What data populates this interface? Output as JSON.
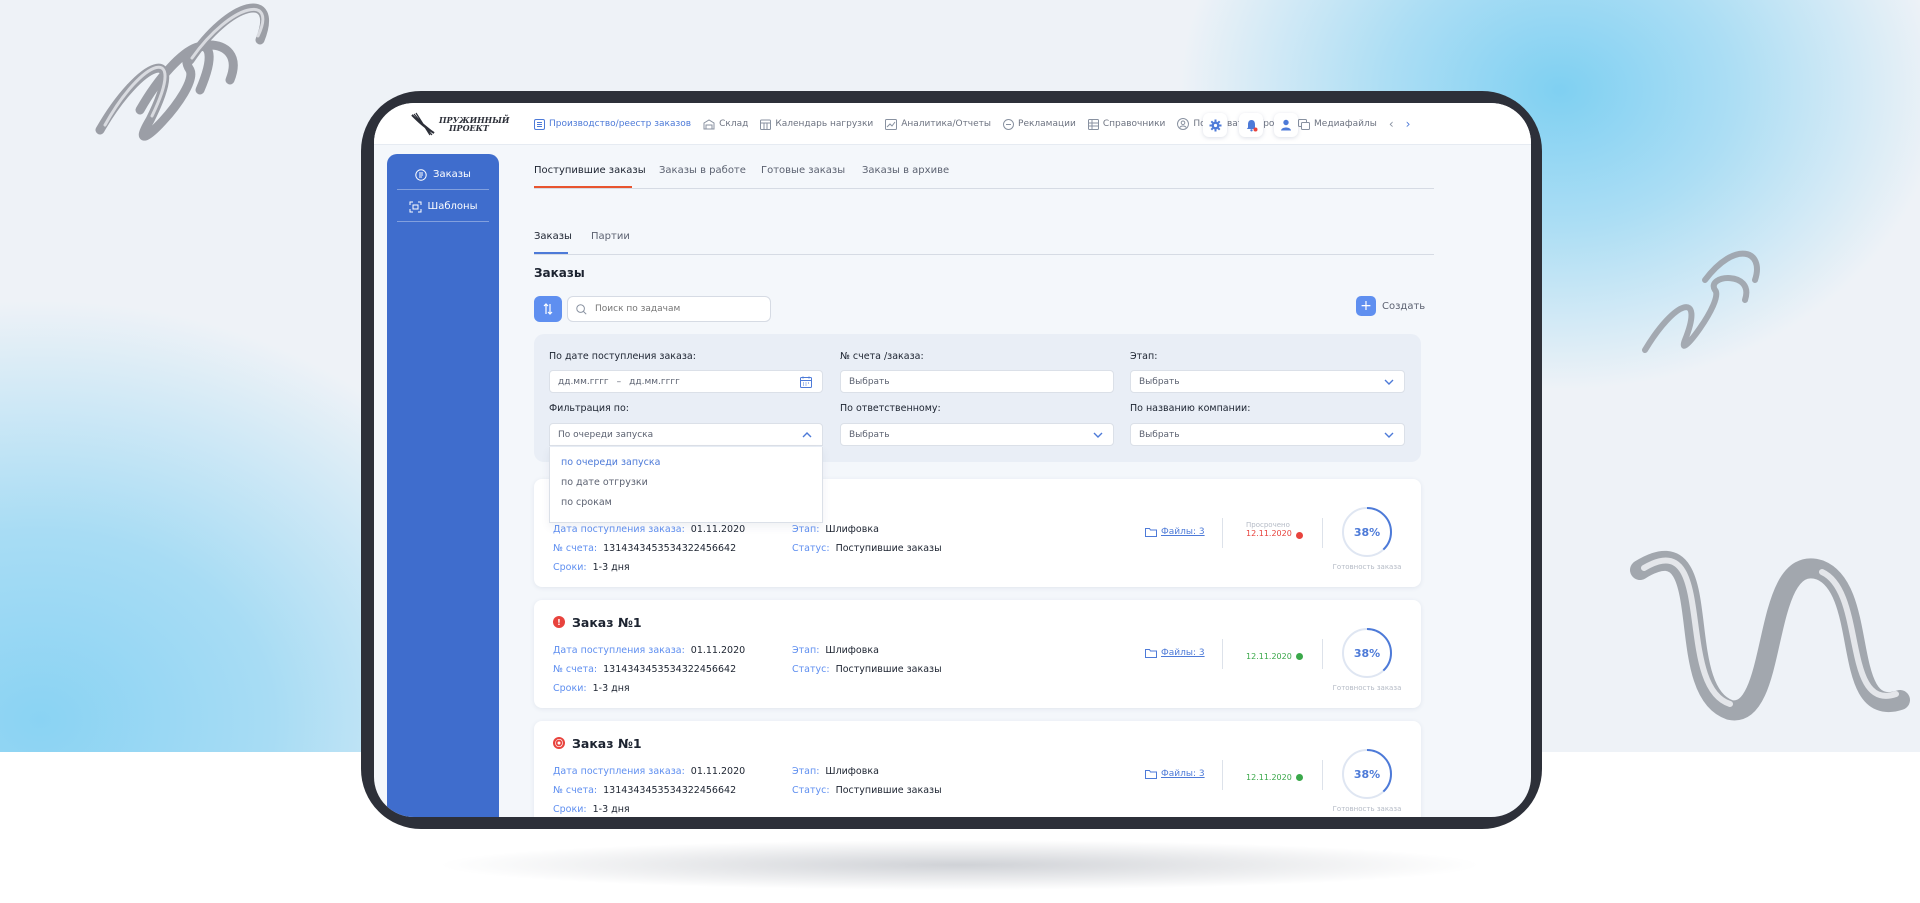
{
  "app": {
    "logo_line1": "ПРУЖИННЫЙ",
    "logo_line2": "ПРОЕКТ"
  },
  "nav": [
    {
      "label": "Производство/реестр заказов",
      "icon": "list-icon",
      "active": true
    },
    {
      "label": "Склад",
      "icon": "warehouse-icon",
      "active": false
    },
    {
      "label": "Календарь нагрузки",
      "icon": "calendar-icon",
      "active": false
    },
    {
      "label": "Аналитика/Отчеты",
      "icon": "chart-icon",
      "active": false
    },
    {
      "label": "Рекламации",
      "icon": "complaint-icon",
      "active": false
    },
    {
      "label": "Справочники",
      "icon": "book-icon",
      "active": false
    },
    {
      "label": "Пользователи/роли",
      "icon": "user-circle-icon",
      "active": false
    },
    {
      "label": "Медиафайлы",
      "icon": "media-icon",
      "active": false
    }
  ],
  "sidebar": {
    "items": [
      {
        "label": "Заказы",
        "icon": "orders-icon"
      },
      {
        "label": "Шаблоны",
        "icon": "templates-icon"
      }
    ]
  },
  "tabs": [
    "Поступившие заказы",
    "Заказы в работе",
    "Готовые заказы",
    "Заказы в архиве"
  ],
  "subtabs": [
    "Заказы",
    "Партии"
  ],
  "section_title": "Заказы",
  "search": {
    "placeholder": "Поиск по задачам"
  },
  "create_label": "Создать",
  "filters": {
    "date_label": "По дате поступления заказа:",
    "date_from_placeholder": "дд.мм.гггг",
    "date_sep": "–",
    "date_to_placeholder": "дд.мм.гггг",
    "invoice_label": "№ счета /заказа:",
    "invoice_placeholder": "Выбрать",
    "stage_label": "Этап:",
    "stage_value": "Выбрать",
    "filter_by_label": "Фильтрация по:",
    "filter_by_value": "По очереди запуска",
    "responsible_label": "По ответственному:",
    "responsible_value": "Выбрать",
    "company_label": "По названию компании:",
    "company_value": "Выбрать",
    "filter_options": [
      "по очереди запуска",
      "по дате отгрузки",
      "по срокам"
    ]
  },
  "labels": {
    "date_received": "Дата поступления заказа:",
    "invoice": "№ счета:",
    "terms": "Сроки:",
    "stage": "Этап:",
    "status": "Статус:",
    "readiness": "Готовность заказа",
    "overdue": "Просрочено"
  },
  "orders": [
    {
      "title": "",
      "date": "01.11.2020",
      "invoice": "1314343453534322456642",
      "terms": "1-3 дня",
      "stage": "Шлифовка",
      "status": "Поступившие заказы",
      "files": "Файлы: 3",
      "due": "12.11.2020",
      "overdue": true,
      "progress": 38,
      "progress_label": "38%"
    },
    {
      "title": "Заказ №1",
      "date": "01.11.2020",
      "invoice": "1314343453534322456642",
      "terms": "1-3 дня",
      "stage": "Шлифовка",
      "status": "Поступившие заказы",
      "files": "Файлы: 3",
      "due": "12.11.2020",
      "overdue": false,
      "progress": 38,
      "progress_label": "38%"
    },
    {
      "title": "Заказ №1",
      "date": "01.11.2020",
      "invoice": "1314343453534322456642",
      "terms": "1-3 дня",
      "stage": "Шлифовка",
      "status": "Поступившие заказы",
      "files": "Файлы: 3",
      "due": "12.11.2020",
      "overdue": false,
      "progress": 38,
      "progress_label": "38%"
    }
  ],
  "colors": {
    "accent": "#4d7ad8",
    "sidebar": "#3f6dcd",
    "tab_active": "#e8542f",
    "overdue": "#e8433d",
    "ok": "#3aa84a"
  }
}
